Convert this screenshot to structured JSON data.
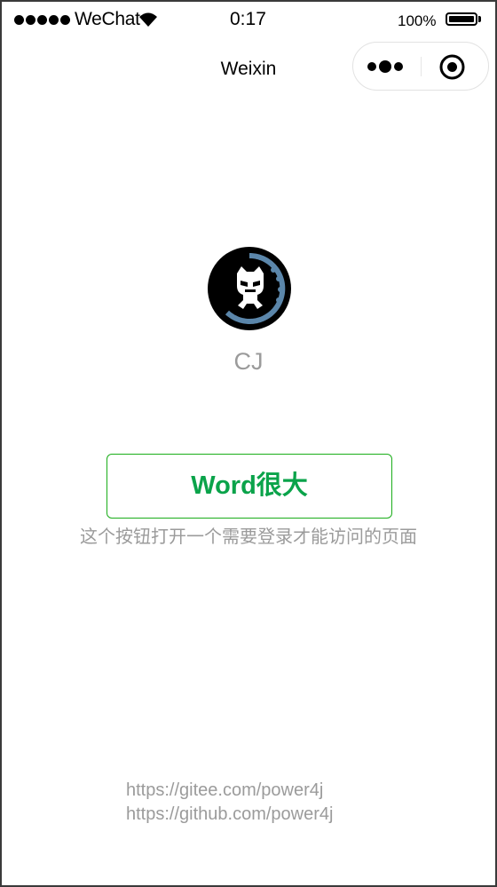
{
  "status_bar": {
    "carrier": "WeChat",
    "time": "0:17",
    "battery": "100%",
    "battery_level": 1.0
  },
  "nav": {
    "title": "Weixin"
  },
  "profile": {
    "avatar_icon": "monstercat-avatar-icon",
    "name": "CJ"
  },
  "main_button": {
    "label": "Word很大"
  },
  "hint_text": "这个按钮打开一个需要登录才能访问的页面",
  "footer_links": [
    "https://gitee.com/power4j",
    "https://github.com/power4j"
  ],
  "colors": {
    "accent_green": "#1aad19",
    "button_text": "#0aa34a",
    "muted_text": "#9b9b9b",
    "avatar_ring": "#5b86aa"
  }
}
